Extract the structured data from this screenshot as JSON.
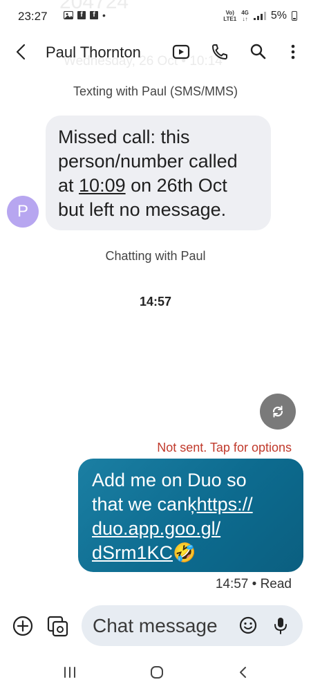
{
  "status_bar": {
    "time": "23:27",
    "network_label_top": "Vo)",
    "network_label_bottom": "LTE1",
    "network_type": "4G",
    "battery": "5%",
    "left_icons": [
      "photo-icon",
      "facebook-icon",
      "facebook-icon"
    ]
  },
  "background_ghost": {
    "number": "204724",
    "date": "Wednesday, 26 Oct • 10:14"
  },
  "header": {
    "contact_name": "Paul Thornton",
    "icons": [
      "back-icon",
      "video-call-icon",
      "phone-icon",
      "search-icon",
      "more-icon"
    ]
  },
  "conversation": {
    "texting_with": "Texting with Paul (SMS/MMS)",
    "avatar_initial": "P",
    "incoming": {
      "line1": "Missed call: this",
      "line2": "person/number called",
      "line3_pre": "at ",
      "line3_time": "10:09",
      "line3_post": " on 26th Oct",
      "line4": "but left no message."
    },
    "chatting_with": "Chatting with Paul",
    "timestamp": "14:57",
    "not_sent": "Not sent. Tap for options",
    "outgoing": {
      "line1": "Add me on Duo so",
      "line2_text": "that we canķ",
      "line2_link": "https://",
      "line3_link": "duo.app.goo.gl/",
      "line4_link": "dSrm1KC",
      "emoji": "🤣"
    },
    "sent_status": "14:57 • Read"
  },
  "compose": {
    "placeholder": "Chat message"
  },
  "colors": {
    "outgoing_bubble": "#0d6b8f",
    "incoming_bubble": "#eeeff3",
    "error": "#c0392b",
    "avatar": "#b7a6f0"
  }
}
